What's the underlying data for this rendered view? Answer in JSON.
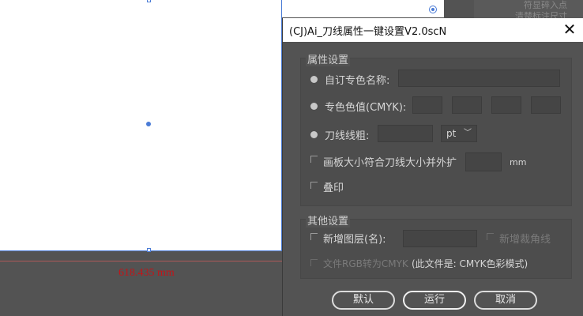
{
  "canvas": {
    "measurement": "618.435 mm",
    "bg_text_1": "符显碎入点",
    "bg_text_2": "清楚标注尺寸"
  },
  "dialog": {
    "title": "(CJ)Ai_刀线属性一键设置V2.0scN",
    "close_icon": "close-icon",
    "attr_group": {
      "title": "属性设置",
      "custom_name_label": "自订专色名称:",
      "spot_value_label": "专色色值(CMYK):",
      "stroke_weight_label": "刀线线粗:",
      "unit_select": "pt",
      "artboard_fit_label": "画板大小符合刀线大小并外扩",
      "unit_mm": "mm",
      "overprint_label": "叠印"
    },
    "other_group": {
      "title": "其他设置",
      "new_layer_label": "新增图层(名):",
      "new_corner_label": "新增裁角线",
      "rgb_to_cmyk_label": "文件RGB转为CMYK",
      "file_mode_note": "(此文件是: CMYK色彩模式)"
    },
    "buttons": {
      "default": "默认",
      "run": "运行",
      "cancel": "取消"
    }
  }
}
